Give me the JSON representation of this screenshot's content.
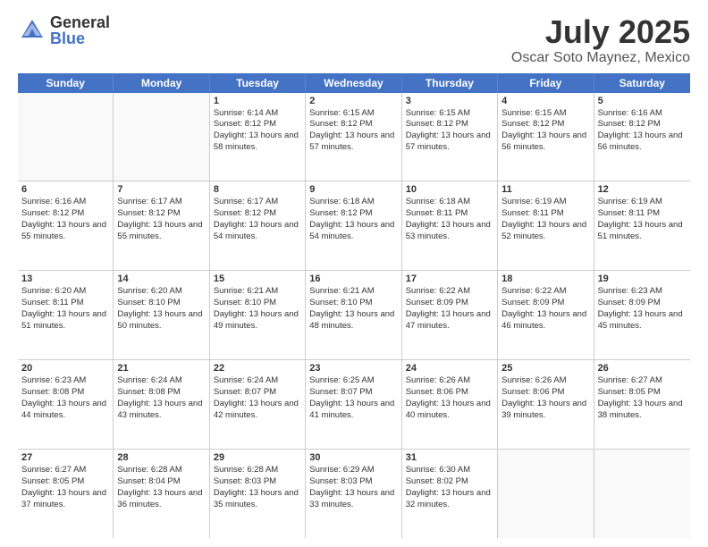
{
  "header": {
    "logo_general": "General",
    "logo_blue": "Blue",
    "cal_title": "July 2025",
    "cal_subtitle": "Oscar Soto Maynez, Mexico"
  },
  "weekdays": [
    "Sunday",
    "Monday",
    "Tuesday",
    "Wednesday",
    "Thursday",
    "Friday",
    "Saturday"
  ],
  "weeks": [
    [
      {
        "day": "",
        "sunrise": "",
        "sunset": "",
        "daylight": "",
        "empty": true
      },
      {
        "day": "",
        "sunrise": "",
        "sunset": "",
        "daylight": "",
        "empty": true
      },
      {
        "day": "1",
        "sunrise": "Sunrise: 6:14 AM",
        "sunset": "Sunset: 8:12 PM",
        "daylight": "Daylight: 13 hours and 58 minutes.",
        "empty": false
      },
      {
        "day": "2",
        "sunrise": "Sunrise: 6:15 AM",
        "sunset": "Sunset: 8:12 PM",
        "daylight": "Daylight: 13 hours and 57 minutes.",
        "empty": false
      },
      {
        "day": "3",
        "sunrise": "Sunrise: 6:15 AM",
        "sunset": "Sunset: 8:12 PM",
        "daylight": "Daylight: 13 hours and 57 minutes.",
        "empty": false
      },
      {
        "day": "4",
        "sunrise": "Sunrise: 6:15 AM",
        "sunset": "Sunset: 8:12 PM",
        "daylight": "Daylight: 13 hours and 56 minutes.",
        "empty": false
      },
      {
        "day": "5",
        "sunrise": "Sunrise: 6:16 AM",
        "sunset": "Sunset: 8:12 PM",
        "daylight": "Daylight: 13 hours and 56 minutes.",
        "empty": false
      }
    ],
    [
      {
        "day": "6",
        "sunrise": "Sunrise: 6:16 AM",
        "sunset": "Sunset: 8:12 PM",
        "daylight": "Daylight: 13 hours and 55 minutes.",
        "empty": false
      },
      {
        "day": "7",
        "sunrise": "Sunrise: 6:17 AM",
        "sunset": "Sunset: 8:12 PM",
        "daylight": "Daylight: 13 hours and 55 minutes.",
        "empty": false
      },
      {
        "day": "8",
        "sunrise": "Sunrise: 6:17 AM",
        "sunset": "Sunset: 8:12 PM",
        "daylight": "Daylight: 13 hours and 54 minutes.",
        "empty": false
      },
      {
        "day": "9",
        "sunrise": "Sunrise: 6:18 AM",
        "sunset": "Sunset: 8:12 PM",
        "daylight": "Daylight: 13 hours and 54 minutes.",
        "empty": false
      },
      {
        "day": "10",
        "sunrise": "Sunrise: 6:18 AM",
        "sunset": "Sunset: 8:11 PM",
        "daylight": "Daylight: 13 hours and 53 minutes.",
        "empty": false
      },
      {
        "day": "11",
        "sunrise": "Sunrise: 6:19 AM",
        "sunset": "Sunset: 8:11 PM",
        "daylight": "Daylight: 13 hours and 52 minutes.",
        "empty": false
      },
      {
        "day": "12",
        "sunrise": "Sunrise: 6:19 AM",
        "sunset": "Sunset: 8:11 PM",
        "daylight": "Daylight: 13 hours and 51 minutes.",
        "empty": false
      }
    ],
    [
      {
        "day": "13",
        "sunrise": "Sunrise: 6:20 AM",
        "sunset": "Sunset: 8:11 PM",
        "daylight": "Daylight: 13 hours and 51 minutes.",
        "empty": false
      },
      {
        "day": "14",
        "sunrise": "Sunrise: 6:20 AM",
        "sunset": "Sunset: 8:10 PM",
        "daylight": "Daylight: 13 hours and 50 minutes.",
        "empty": false
      },
      {
        "day": "15",
        "sunrise": "Sunrise: 6:21 AM",
        "sunset": "Sunset: 8:10 PM",
        "daylight": "Daylight: 13 hours and 49 minutes.",
        "empty": false
      },
      {
        "day": "16",
        "sunrise": "Sunrise: 6:21 AM",
        "sunset": "Sunset: 8:10 PM",
        "daylight": "Daylight: 13 hours and 48 minutes.",
        "empty": false
      },
      {
        "day": "17",
        "sunrise": "Sunrise: 6:22 AM",
        "sunset": "Sunset: 8:09 PM",
        "daylight": "Daylight: 13 hours and 47 minutes.",
        "empty": false
      },
      {
        "day": "18",
        "sunrise": "Sunrise: 6:22 AM",
        "sunset": "Sunset: 8:09 PM",
        "daylight": "Daylight: 13 hours and 46 minutes.",
        "empty": false
      },
      {
        "day": "19",
        "sunrise": "Sunrise: 6:23 AM",
        "sunset": "Sunset: 8:09 PM",
        "daylight": "Daylight: 13 hours and 45 minutes.",
        "empty": false
      }
    ],
    [
      {
        "day": "20",
        "sunrise": "Sunrise: 6:23 AM",
        "sunset": "Sunset: 8:08 PM",
        "daylight": "Daylight: 13 hours and 44 minutes.",
        "empty": false
      },
      {
        "day": "21",
        "sunrise": "Sunrise: 6:24 AM",
        "sunset": "Sunset: 8:08 PM",
        "daylight": "Daylight: 13 hours and 43 minutes.",
        "empty": false
      },
      {
        "day": "22",
        "sunrise": "Sunrise: 6:24 AM",
        "sunset": "Sunset: 8:07 PM",
        "daylight": "Daylight: 13 hours and 42 minutes.",
        "empty": false
      },
      {
        "day": "23",
        "sunrise": "Sunrise: 6:25 AM",
        "sunset": "Sunset: 8:07 PM",
        "daylight": "Daylight: 13 hours and 41 minutes.",
        "empty": false
      },
      {
        "day": "24",
        "sunrise": "Sunrise: 6:26 AM",
        "sunset": "Sunset: 8:06 PM",
        "daylight": "Daylight: 13 hours and 40 minutes.",
        "empty": false
      },
      {
        "day": "25",
        "sunrise": "Sunrise: 6:26 AM",
        "sunset": "Sunset: 8:06 PM",
        "daylight": "Daylight: 13 hours and 39 minutes.",
        "empty": false
      },
      {
        "day": "26",
        "sunrise": "Sunrise: 6:27 AM",
        "sunset": "Sunset: 8:05 PM",
        "daylight": "Daylight: 13 hours and 38 minutes.",
        "empty": false
      }
    ],
    [
      {
        "day": "27",
        "sunrise": "Sunrise: 6:27 AM",
        "sunset": "Sunset: 8:05 PM",
        "daylight": "Daylight: 13 hours and 37 minutes.",
        "empty": false
      },
      {
        "day": "28",
        "sunrise": "Sunrise: 6:28 AM",
        "sunset": "Sunset: 8:04 PM",
        "daylight": "Daylight: 13 hours and 36 minutes.",
        "empty": false
      },
      {
        "day": "29",
        "sunrise": "Sunrise: 6:28 AM",
        "sunset": "Sunset: 8:03 PM",
        "daylight": "Daylight: 13 hours and 35 minutes.",
        "empty": false
      },
      {
        "day": "30",
        "sunrise": "Sunrise: 6:29 AM",
        "sunset": "Sunset: 8:03 PM",
        "daylight": "Daylight: 13 hours and 33 minutes.",
        "empty": false
      },
      {
        "day": "31",
        "sunrise": "Sunrise: 6:30 AM",
        "sunset": "Sunset: 8:02 PM",
        "daylight": "Daylight: 13 hours and 32 minutes.",
        "empty": false
      },
      {
        "day": "",
        "sunrise": "",
        "sunset": "",
        "daylight": "",
        "empty": true
      },
      {
        "day": "",
        "sunrise": "",
        "sunset": "",
        "daylight": "",
        "empty": true
      }
    ]
  ]
}
